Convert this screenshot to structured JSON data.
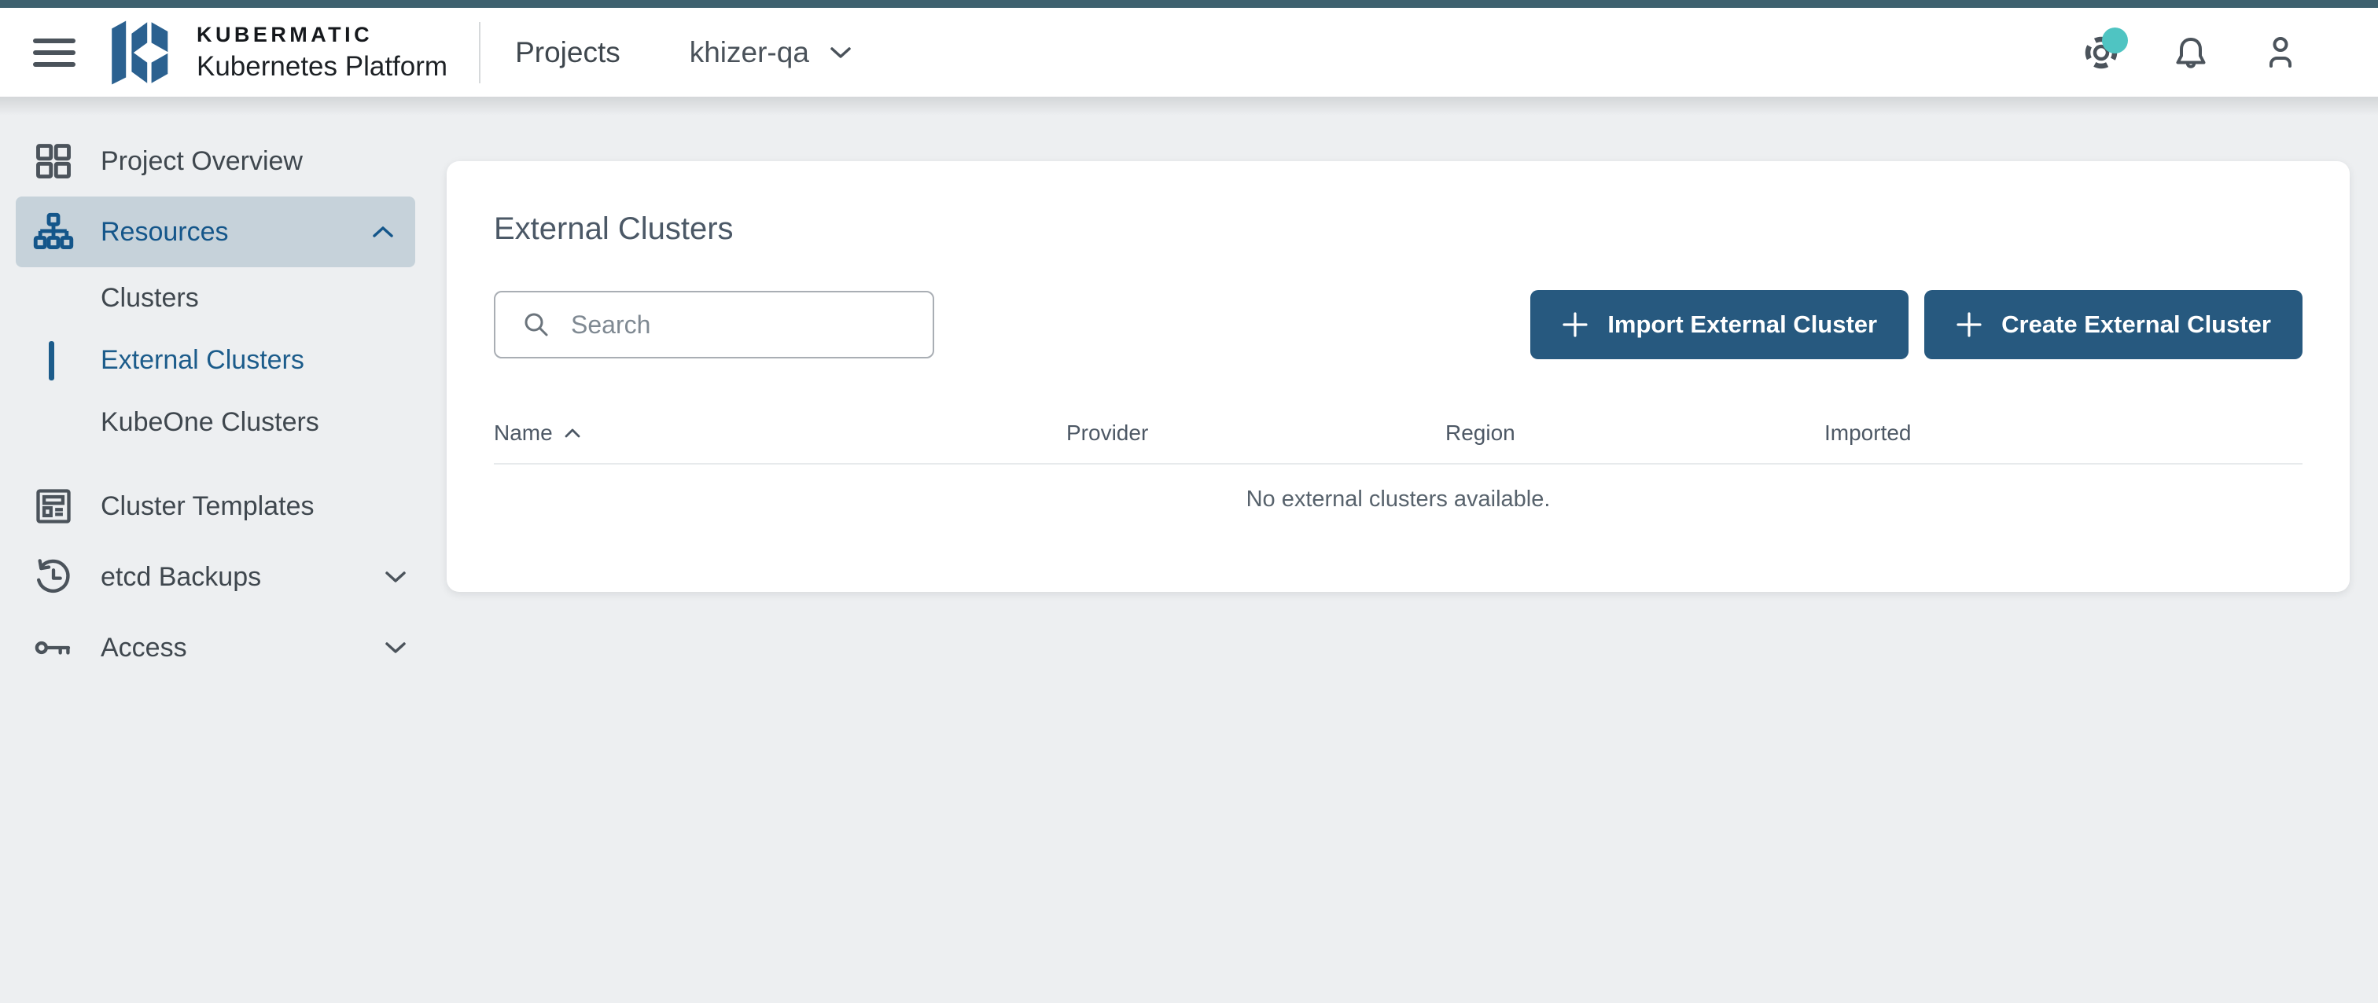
{
  "header": {
    "brand_top": "KUBERMATIC",
    "brand_bottom": "Kubernetes Platform",
    "projects_label": "Projects",
    "project_name": "khizer-qa"
  },
  "sidebar": {
    "items": [
      {
        "label": "Project Overview",
        "icon": "grid-icon"
      },
      {
        "label": "Resources",
        "icon": "sitemap-icon",
        "expanded": true,
        "active": true
      },
      {
        "label": "Clusters",
        "child": true
      },
      {
        "label": "External Clusters",
        "child": true,
        "selected": true
      },
      {
        "label": "KubeOne Clusters",
        "child": true
      },
      {
        "label": "Cluster Templates",
        "icon": "template-icon"
      },
      {
        "label": "etcd Backups",
        "icon": "history-icon",
        "collapsed": true
      },
      {
        "label": "Access",
        "icon": "key-icon",
        "collapsed": true
      }
    ]
  },
  "main": {
    "title": "External Clusters",
    "search_placeholder": "Search",
    "buttons": [
      {
        "label": "Import External Cluster"
      },
      {
        "label": "Create External Cluster"
      }
    ],
    "table": {
      "columns": [
        "Name",
        "Provider",
        "Region",
        "Imported"
      ],
      "sorted_column": "Name",
      "sort_direction": "asc",
      "empty_message": "No external clusters available."
    }
  },
  "colors": {
    "top_strip": "#3e616f",
    "brand_blue": "#2b6190",
    "button_blue": "#27597f",
    "selected_blue": "#1c5c8b",
    "active_row_bg": "#c6d2da",
    "badge_teal": "#4fc4c2",
    "page_bg": "#edeff1"
  }
}
